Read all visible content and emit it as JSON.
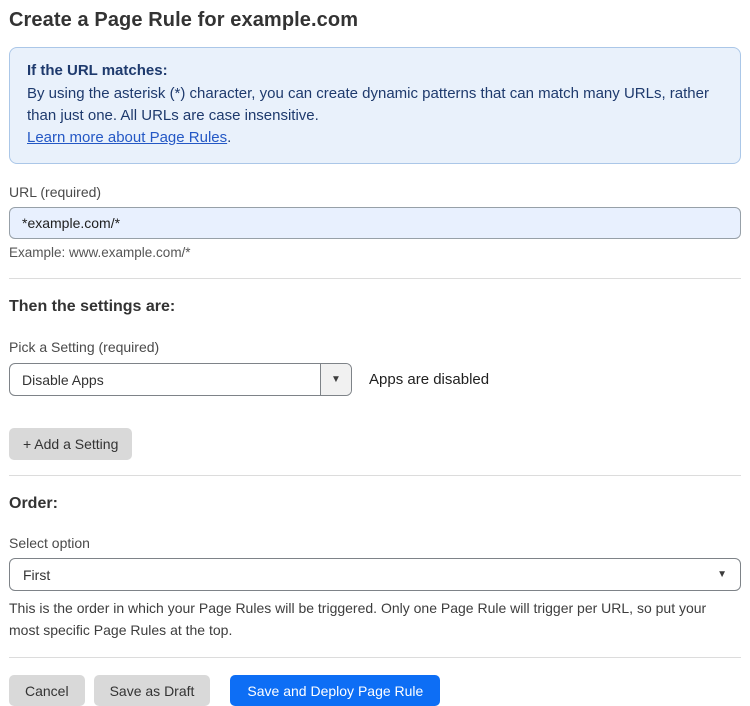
{
  "page": {
    "title": "Create a Page Rule for example.com"
  },
  "info_box": {
    "heading": "If the URL matches:",
    "body": "By using the asterisk (*) character, you can create dynamic patterns that can match many URLs, rather than just one. All URLs are case insensitive.",
    "link_label": "Learn more about Page Rules",
    "link_suffix": "."
  },
  "url_section": {
    "label": "URL (required)",
    "value": "*example.com/*",
    "example": "Example: www.example.com/*"
  },
  "settings_section": {
    "heading": "Then the settings are:",
    "picker_label": "Pick a Setting (required)",
    "selected_setting": "Disable Apps",
    "setting_description": "Apps are disabled",
    "add_setting_label": "+ Add a Setting",
    "dropdown_arrow": "▼"
  },
  "order_section": {
    "heading": "Order:",
    "label": "Select option",
    "selected_option": "First",
    "description": "This is the order in which your Page Rules will be triggered. Only one Page Rule will trigger per URL, so put your most specific Page Rules at the top.",
    "dropdown_arrow": "▼"
  },
  "footer": {
    "cancel_label": "Cancel",
    "save_draft_label": "Save as Draft",
    "save_deploy_label": "Save and Deploy Page Rule"
  },
  "colors": {
    "accent_blue": "#0d6ef5",
    "info_background": "#e9f1fb",
    "info_border": "#abc7e8",
    "info_text": "#1e3a6d",
    "link_blue": "#2458c5",
    "input_background": "#e8f0fe",
    "button_gray": "#d9d9d9"
  }
}
